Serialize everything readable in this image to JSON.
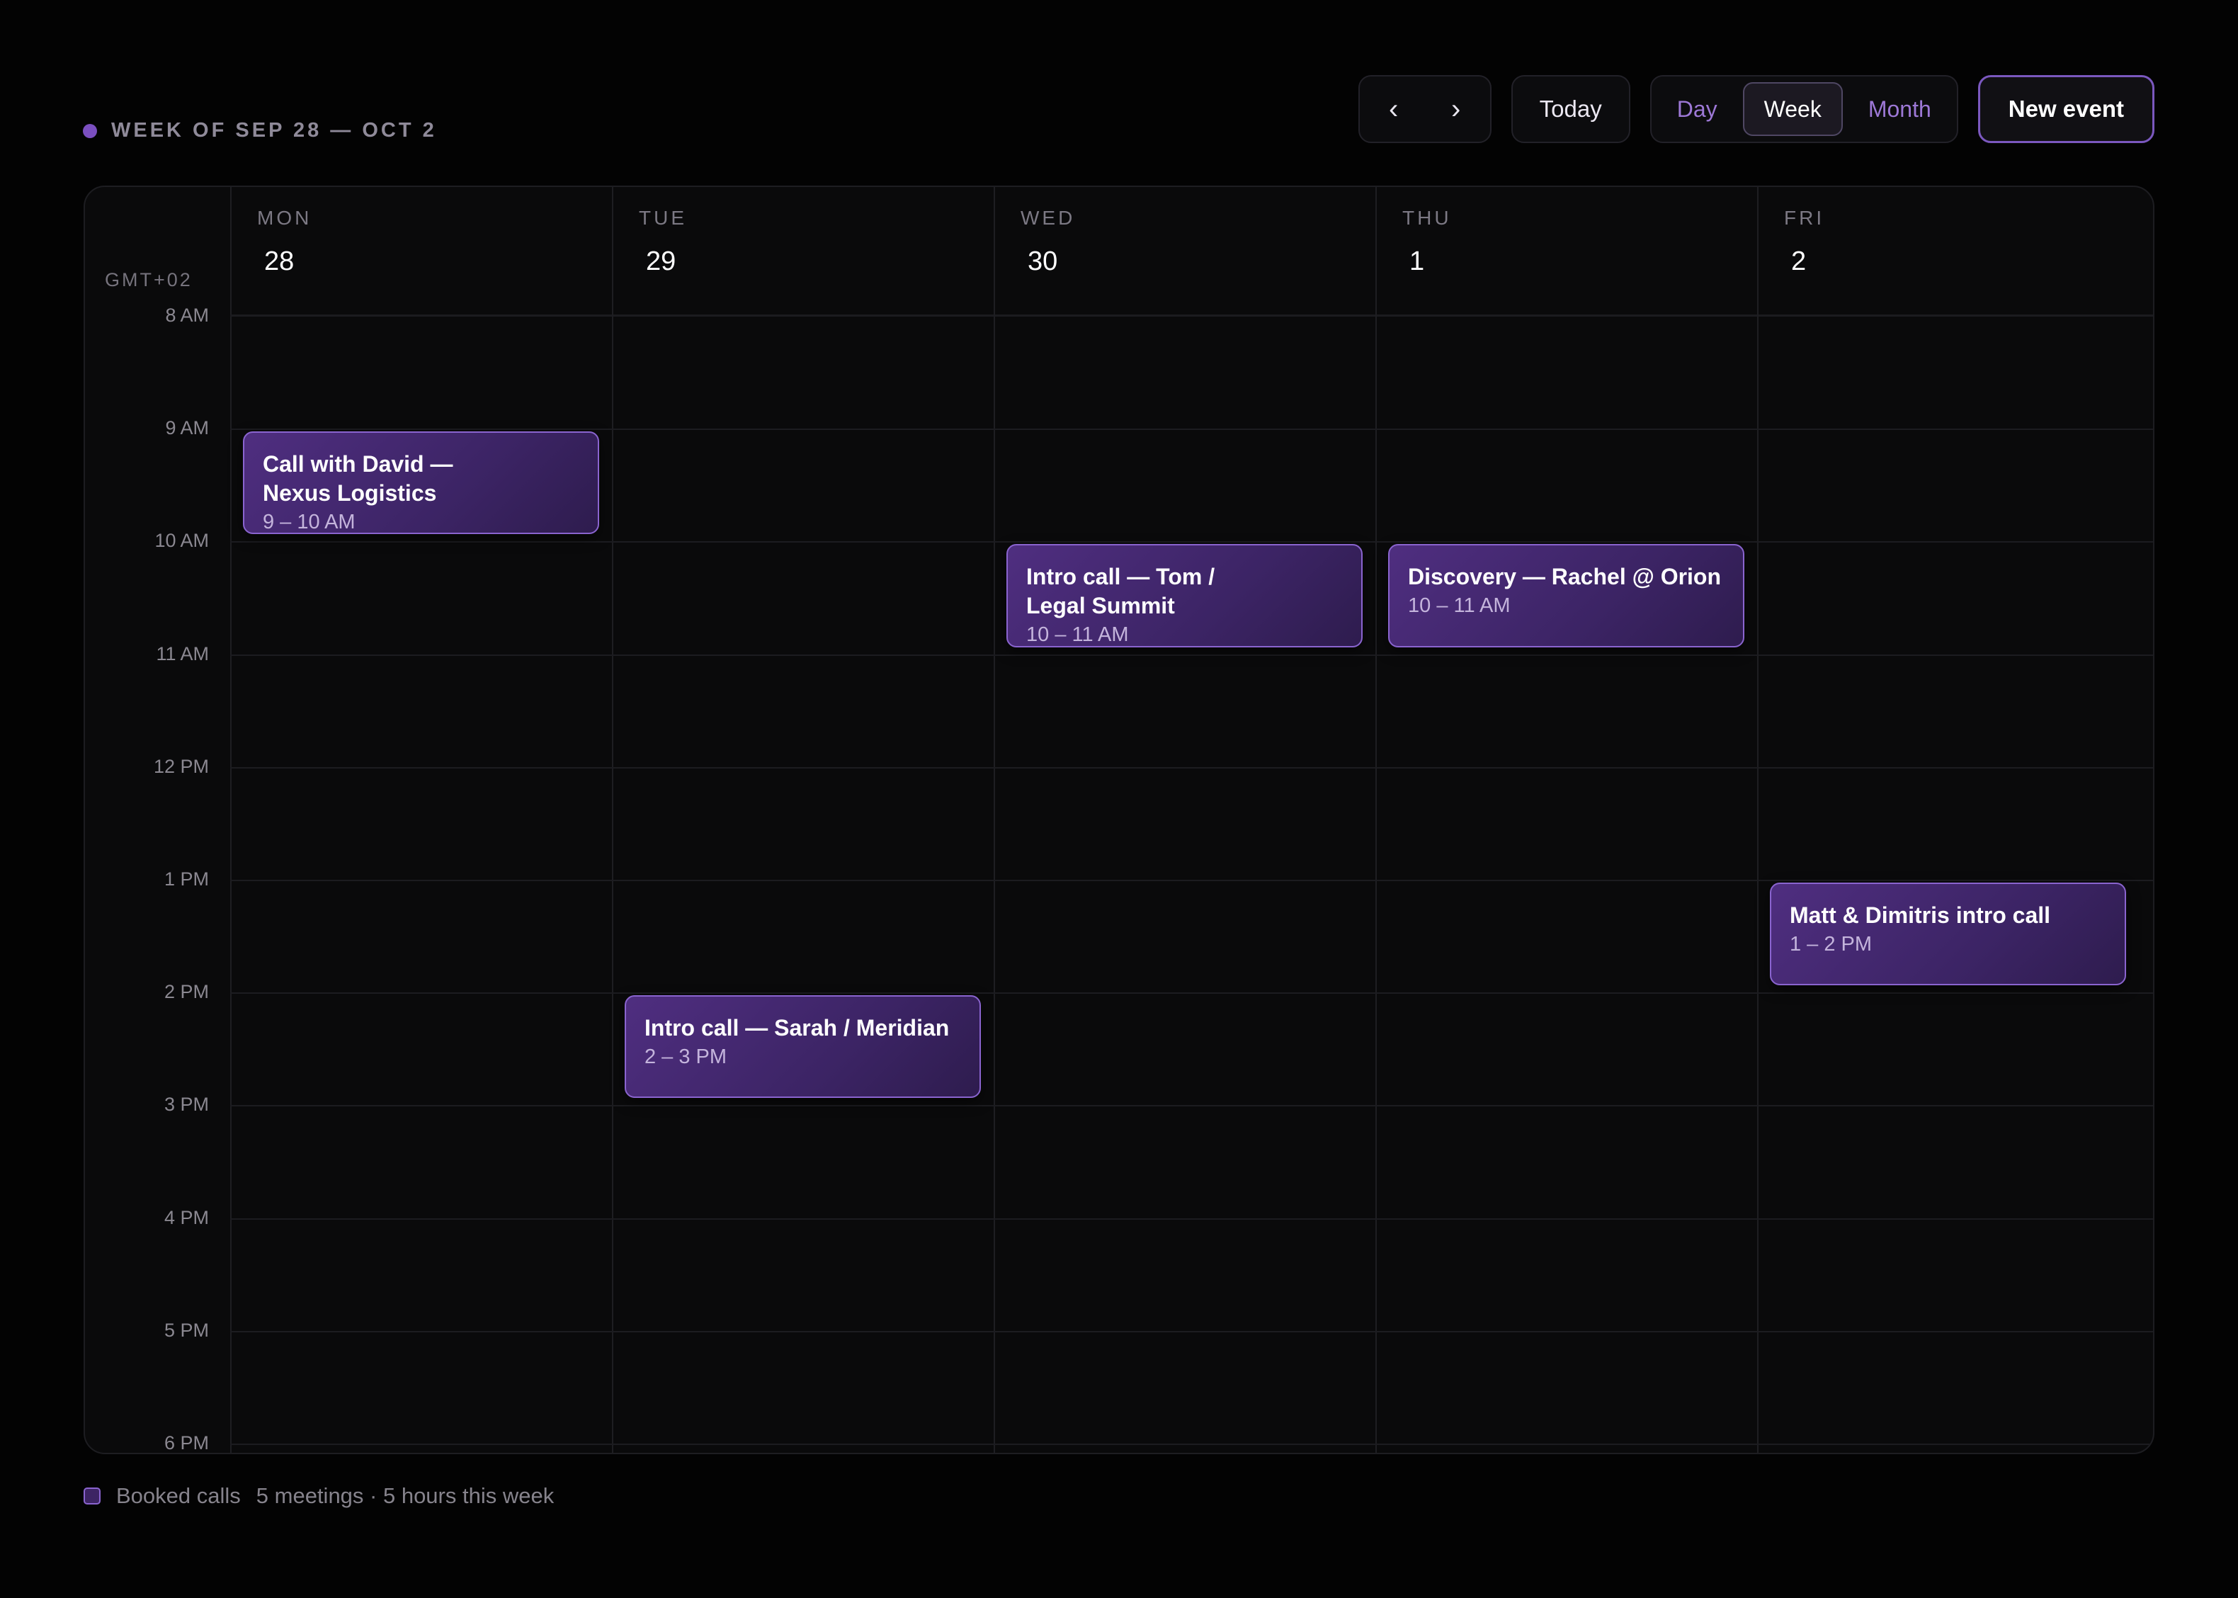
{
  "header": {
    "week_label": "WEEK OF SEP 28 — OCT 2",
    "prev_icon": "‹",
    "next_icon": "›",
    "today_label": "Today",
    "views": [
      "Day",
      "Week",
      "Month"
    ],
    "active_view": "Week",
    "new_event_label": "New event"
  },
  "calendar": {
    "timezone": "GMT+02",
    "days": [
      {
        "name": "MON",
        "date": "28"
      },
      {
        "name": "TUE",
        "date": "29"
      },
      {
        "name": "WED",
        "date": "30"
      },
      {
        "name": "THU",
        "date": "1"
      },
      {
        "name": "FRI",
        "date": "2"
      }
    ],
    "hours": [
      "8 AM",
      "9 AM",
      "10 AM",
      "11 AM",
      "12 PM",
      "1 PM",
      "2 PM",
      "3 PM",
      "4 PM",
      "5 PM",
      "6 PM"
    ],
    "events": [
      {
        "day": 0,
        "start": 9,
        "end": 10,
        "title": "Call with David — Nexus Logistics",
        "time": "9 – 10 AM"
      },
      {
        "day": 2,
        "start": 10,
        "end": 11,
        "title": "Intro call — Tom / Legal Summit",
        "time": "10 – 11 AM"
      },
      {
        "day": 3,
        "start": 10,
        "end": 11,
        "title": "Discovery — Rachel @ Orion",
        "time": "10 – 11 AM"
      },
      {
        "day": 4,
        "start": 13,
        "end": 14,
        "title": "Matt & Dimitris intro call",
        "time": "1 – 2 PM"
      },
      {
        "day": 1,
        "start": 14,
        "end": 15,
        "title": "Intro call — Sarah / Meridian",
        "time": "2 – 3 PM"
      }
    ]
  },
  "footer": {
    "legend_label": "Booked calls",
    "summary": "5 meetings · 5 hours this week"
  },
  "colors": {
    "accent": "#7b4fc0",
    "event_fill": "#3c2465",
    "event_border": "#8a64cf",
    "background": "#030303"
  }
}
